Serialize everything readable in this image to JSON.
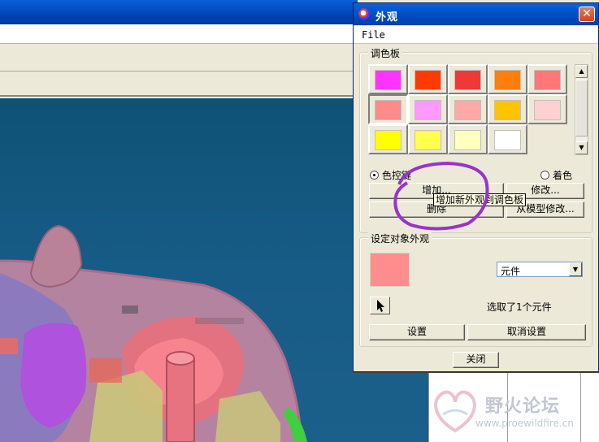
{
  "dialog": {
    "title": "外观",
    "close_glyph": "✕",
    "menu": {
      "file": "File"
    },
    "palette_group": {
      "legend": "调色板",
      "swatches": [
        "#ff33ff",
        "#ff3a00",
        "#f03838",
        "#ff7e0c",
        "#ff7878",
        "#ff8a8a",
        "#ff99ff",
        "#ffa8a8",
        "#ffc400",
        "#ffd0d0",
        "#ffff00",
        "#ffff4c",
        "#ffffbe",
        "#ffffff"
      ],
      "selected_index": 5,
      "radio_color_label": "色控键",
      "radio_shade_label": "着色",
      "add_button": "增加...",
      "modify_button": "修改...",
      "delete_button": "删除",
      "from_model_button": "从模型修改...",
      "tooltip": "增加新外观到调色板"
    },
    "set_group": {
      "legend": "设定对象外观",
      "preview_color": "#ff8d8d",
      "select_value": "元件",
      "status": "选取了1个元件",
      "set_button": "设置",
      "unset_button": "取消设置"
    },
    "close_button": "关闭"
  },
  "watermark": {
    "text": "野火论坛",
    "url": "www.proewildfire.cn"
  },
  "icons": [
    "app-icon",
    "close-icon",
    "arrow-cursor-icon",
    "dropdown-arrow-icon",
    "scroll-up-icon",
    "scroll-down-icon"
  ]
}
